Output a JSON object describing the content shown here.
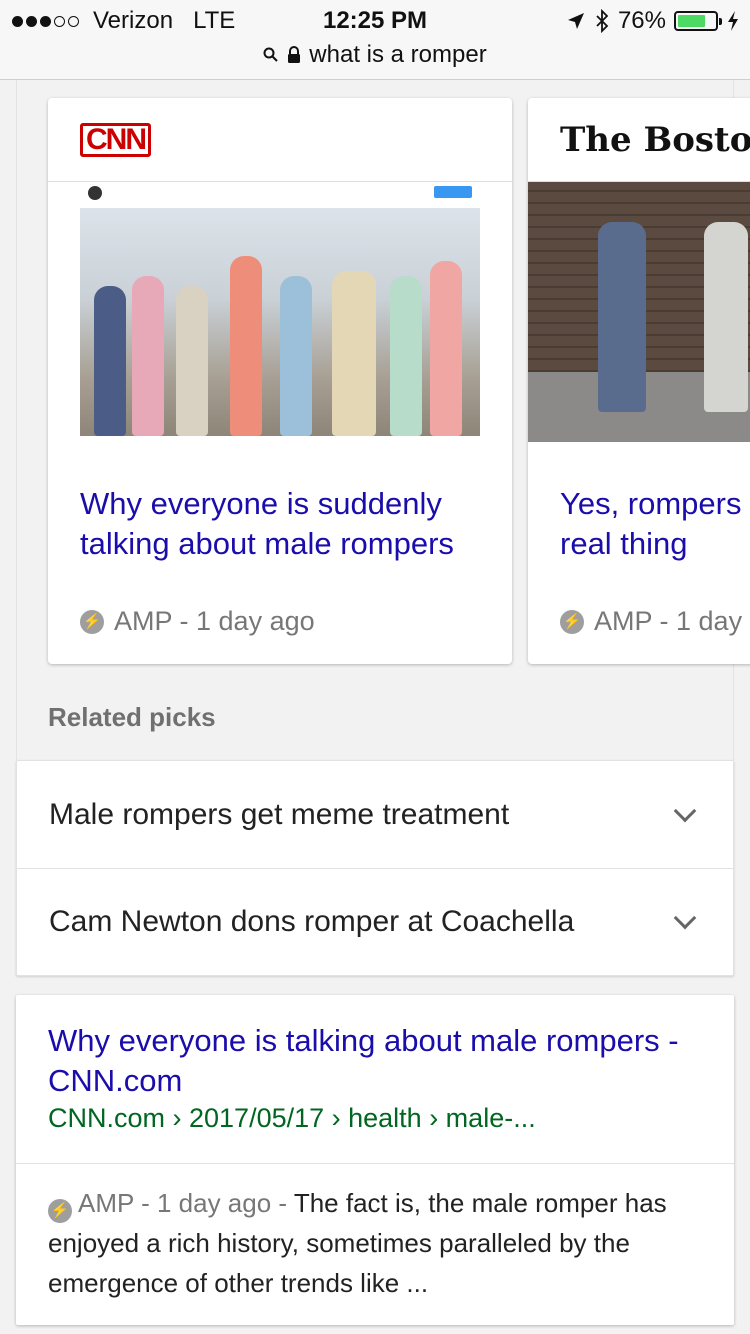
{
  "status_bar": {
    "carrier": "Verizon",
    "network": "LTE",
    "time": "12:25 PM",
    "battery_percent": "76%",
    "battery_level": 0.76
  },
  "url_bar": {
    "query": "what is a romper"
  },
  "carousel": {
    "cards": [
      {
        "source_logo": "CNN",
        "headline": "Why everyone is suddenly talking about male rompers",
        "meta": "AMP - 1 day ago"
      },
      {
        "source_logo": "The Boston Gl",
        "headline": "Yes, rompers real thing",
        "meta": "AMP - 1 day"
      }
    ]
  },
  "related": {
    "title": "Related picks",
    "items": [
      {
        "label": "Male rompers get meme treatment"
      },
      {
        "label": "Cam Newton dons romper at Coachella"
      }
    ]
  },
  "result": {
    "title": "Why everyone is talking about male rompers - CNN.com",
    "breadcrumb": "CNN.com › 2017/05/17 › health › male-...",
    "meta": "AMP - 1 day ago - ",
    "snippet": "The fact is, the male romper has enjoyed a rich history, sometimes paralleled by the emergence of other trends like  ..."
  },
  "colors": {
    "link": "#1a0dab",
    "url_green": "#006621",
    "cnn_red": "#cc0000",
    "battery_green": "#4cd964"
  },
  "icons": [
    "signal-dots-icon",
    "search-icon",
    "lock-icon",
    "location-arrow-icon",
    "bluetooth-icon",
    "battery-icon",
    "charging-bolt-icon",
    "amp-bolt-icon",
    "chevron-down-icon"
  ]
}
